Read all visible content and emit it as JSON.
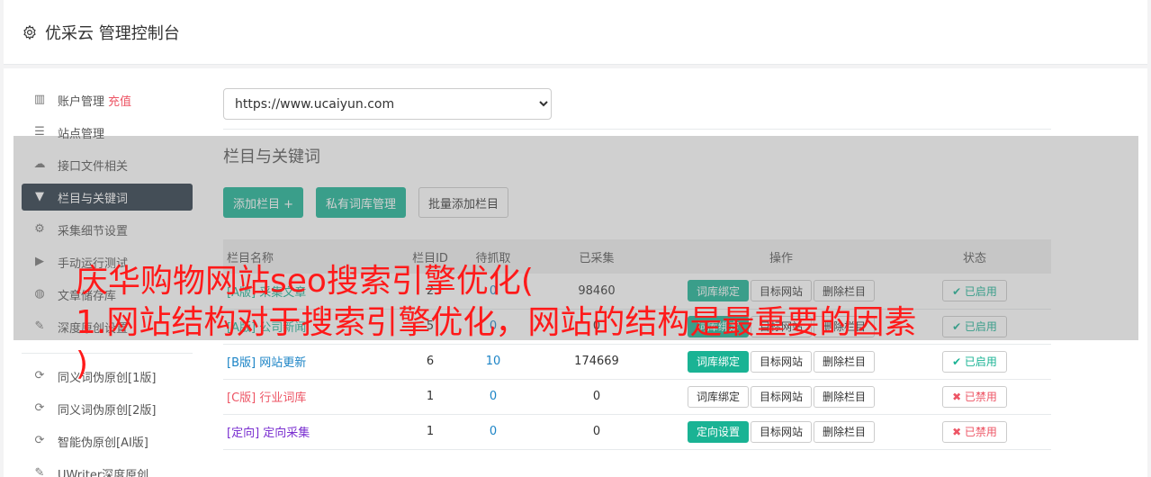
{
  "header": {
    "title": "优采云 管理控制台"
  },
  "sidebar": {
    "items": [
      {
        "label": "账户管理",
        "extra": "充值",
        "icon": "bar-chart-icon",
        "active": false
      },
      {
        "label": "站点管理",
        "icon": "server-icon",
        "active": false
      },
      {
        "label": "接口文件相关",
        "icon": "cloud-upload-icon",
        "active": false
      },
      {
        "label": "栏目与关键词",
        "icon": "filter-icon",
        "active": true
      },
      {
        "label": "采集细节设置",
        "icon": "cogs-icon",
        "active": false
      },
      {
        "label": "手动运行测试",
        "icon": "play-circle-icon",
        "active": false
      },
      {
        "label": "文章储存库",
        "icon": "database-icon",
        "active": false
      },
      {
        "label": "深度原创设置",
        "icon": "edit-icon",
        "active": false
      }
    ],
    "items2": [
      {
        "label": "同义词伪原创[1版]",
        "icon": "refresh-icon"
      },
      {
        "label": "同义词伪原创[2版]",
        "icon": "refresh-icon"
      },
      {
        "label": "智能伪原创[AI版]",
        "icon": "refresh-icon"
      },
      {
        "label": "UWriter深度原创",
        "icon": "edit-icon"
      }
    ]
  },
  "main": {
    "site_select": {
      "value": "https://www.ucaiyun.com"
    },
    "section_title": "栏目与关键词",
    "buttons": {
      "add_column": "添加栏目 +",
      "private_lib": "私有词库管理",
      "batch_add": "批量添加栏目"
    },
    "table": {
      "headers": [
        "栏目名称",
        "栏目ID",
        "待抓取",
        "已采集",
        "操作",
        "状态"
      ],
      "rows": [
        {
          "tag": "[A版]",
          "tag_color": "green",
          "name": "采集文章",
          "id": "2",
          "pending": "0",
          "collected": "98460",
          "op1": "词库绑定",
          "op1_green": true,
          "op2": "目标网站",
          "op3": "删除栏目",
          "status": "✔ 已启用",
          "status_on": true
        },
        {
          "tag": "[A版]",
          "tag_color": "green",
          "name": "公司新闻",
          "id": "5",
          "pending": "0",
          "collected": "0",
          "op1": "词库绑定",
          "op1_green": true,
          "op2": "目标网站",
          "op3": "删除栏目",
          "status": "✔ 已启用",
          "status_on": true
        },
        {
          "tag": "[B版]",
          "tag_color": "blue",
          "name": "网站更新",
          "id": "6",
          "pending": "10",
          "collected": "174669",
          "op1": "词库绑定",
          "op1_green": true,
          "op2": "目标网站",
          "op3": "删除栏目",
          "status": "✔ 已启用",
          "status_on": true
        },
        {
          "tag": "[C版]",
          "tag_color": "red",
          "name": "行业词库",
          "id": "1",
          "pending": "0",
          "collected": "0",
          "op1": "词库绑定",
          "op1_green": false,
          "op2": "目标网站",
          "op3": "删除栏目",
          "status": "✖ 已禁用",
          "status_on": false
        },
        {
          "tag": "[定向]",
          "tag_color": "purple",
          "name": "定向采集",
          "id": "1",
          "pending": "0",
          "collected": "0",
          "op1": "定向设置",
          "op1_green": true,
          "op2": "目标网站",
          "op3": "删除栏目",
          "status": "✖ 已禁用",
          "status_on": false
        }
      ]
    }
  },
  "headline": {
    "line1": "庆华购物网站seo搜索引擎优化(",
    "line2": "1.网站结构对于搜索引擎优化，网站的结构是最重要的因素",
    "line3": ")"
  },
  "colors": {
    "accent_green": "#1ab394",
    "sidebar_active": "#293846",
    "headline_red": "#ff1a1a",
    "link_blue": "#1c84c6",
    "danger_red": "#ed5565"
  }
}
